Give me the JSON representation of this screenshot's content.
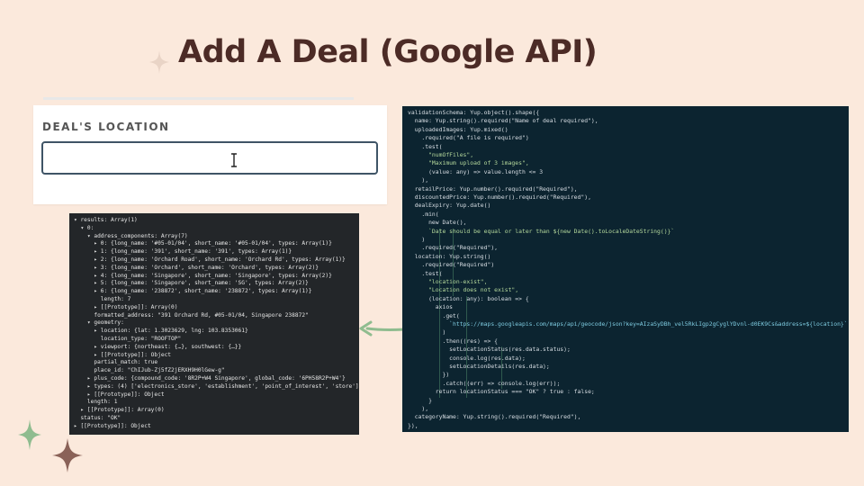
{
  "slide": {
    "title": "Add A Deal (Google API)",
    "background": "#fbe9dc",
    "accent": "#8fbc8f",
    "title_color": "#4c2b26"
  },
  "form": {
    "label": "DEAL'S LOCATION",
    "input_value": "",
    "cursor_icon": "text-cursor-icon"
  },
  "console": {
    "lines": [
      "▾ results: Array(1)",
      "  ▾ 0:",
      "    ▾ address_components: Array(7)",
      "      ▸ 0: {long_name: '#05-01/04', short_name: '#05-01/04', types: Array(1)}",
      "      ▸ 1: {long_name: '391', short_name: '391', types: Array(1)}",
      "      ▸ 2: {long_name: 'Orchard Road', short_name: 'Orchard Rd', types: Array(1)}",
      "      ▸ 3: {long_name: 'Orchard', short_name: 'Orchard', types: Array(2)}",
      "      ▸ 4: {long_name: 'Singapore', short_name: 'Singapore', types: Array(2)}",
      "      ▸ 5: {long_name: 'Singapore', short_name: 'SG', types: Array(2)}",
      "      ▸ 6: {long_name: '238872', short_name: '238872', types: Array(1)}",
      "        length: 7",
      "      ▸ [[Prototype]]: Array(0)",
      "      formatted_address: \"391 Orchard Rd, #05-01/04, Singapore 238872\"",
      "    ▾ geometry:",
      "      ▸ location: {lat: 1.3023629, lng: 103.8353061}",
      "        location_type: \"ROOFTOP\"",
      "      ▸ viewport: {northeast: {…}, southwest: {…}}",
      "      ▸ [[Prototype]]: Object",
      "      partial_match: true",
      "      place_id: \"ChIJub-Zj5fZ2jERXH9H0lGew-g\"",
      "    ▸ plus_code: {compound_code: '8R2P+W4 Singapore', global_code: '6PH58R2P+W4'}",
      "    ▸ types: (4) ['electronics_store', 'establishment', 'point_of_interest', 'store']",
      "    ▸ [[Prototype]]: Object",
      "    length: 1",
      "  ▸ [[Prototype]]: Array(0)",
      "  status: \"OK\"",
      "▸ [[Prototype]]: Object"
    ]
  },
  "code": {
    "lines": [
      "validationSchema: Yup.object().shape({",
      "  name: Yup.string().required(\"Name of deal required\"),",
      "  uploadedImages: Yup.mixed()",
      "    .required(\"A file is required\")",
      "    .test(",
      "      \"numOfFiles\",",
      "      \"Maximum upload of 3 images\",",
      "      (value: any) => value.length <= 3",
      "    ),",
      "  retailPrice: Yup.number().required(\"Required\"),",
      "  discountedPrice: Yup.number().required(\"Required\"),",
      "  dealExpiry: Yup.date()",
      "    .min(",
      "      new Date(),",
      "      `Date should be equal or later than ${new Date().toLocaleDateString()}`",
      "    )",
      "    .required(\"Required\"),",
      "  location: Yup.string()",
      "    .required(\"Required\")",
      "    .test(",
      "      \"location-exist\",",
      "      \"Location does not exist\",",
      "      (location: any): boolean => {",
      "        axios",
      "          .get(",
      "            `https://maps.googleapis.com/maps/api/geocode/json?key=AIzaSyDBh_vel5RkLIgp2gCyglYDvnl-d0EK9Cs&address=${location}`",
      "          )",
      "          .then((res) => {",
      "            setLocationStatus(res.data.status);",
      "            console.log(res.data);",
      "            setLocationDetails(res.data);",
      "          })",
      "          .catch((err) => console.log(err));",
      "        return locationStatus === \"OK\" ? true : false;",
      "      }",
      "    ),",
      "  categoryName: Yup.string().required(\"Required\"),",
      "}),"
    ]
  }
}
